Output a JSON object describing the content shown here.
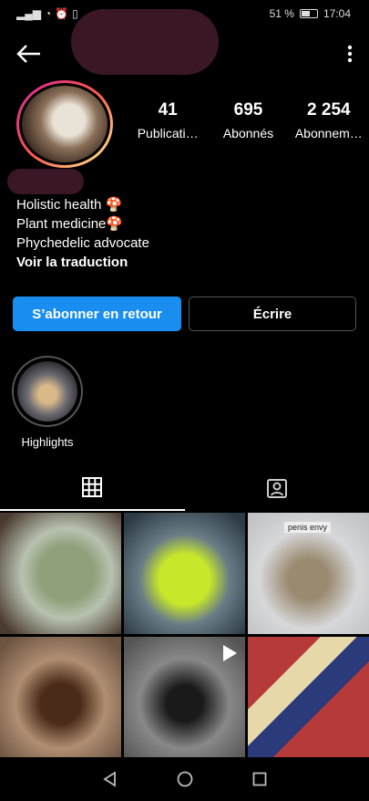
{
  "status": {
    "battery": "51 %",
    "time": "17:04"
  },
  "profile": {
    "stats": [
      {
        "value": "41",
        "label": "Publicati…"
      },
      {
        "value": "695",
        "label": "Abonnés"
      },
      {
        "value": "2 254",
        "label": "Abonnem…"
      }
    ],
    "bio": [
      "Holistic health 🍄",
      "Plant medicine🍄",
      "Phychedelic advocate"
    ],
    "translate_label": "Voir la traduction"
  },
  "actions": {
    "follow_back": "S’abonner en retour",
    "message": "Écrire"
  },
  "highlights": [
    {
      "label": "Highlights"
    }
  ],
  "grid": {
    "tag_text": "penis envy"
  },
  "colors": {
    "accent": "#1a8ef0",
    "background": "#000000",
    "redaction": "#3a1726"
  }
}
